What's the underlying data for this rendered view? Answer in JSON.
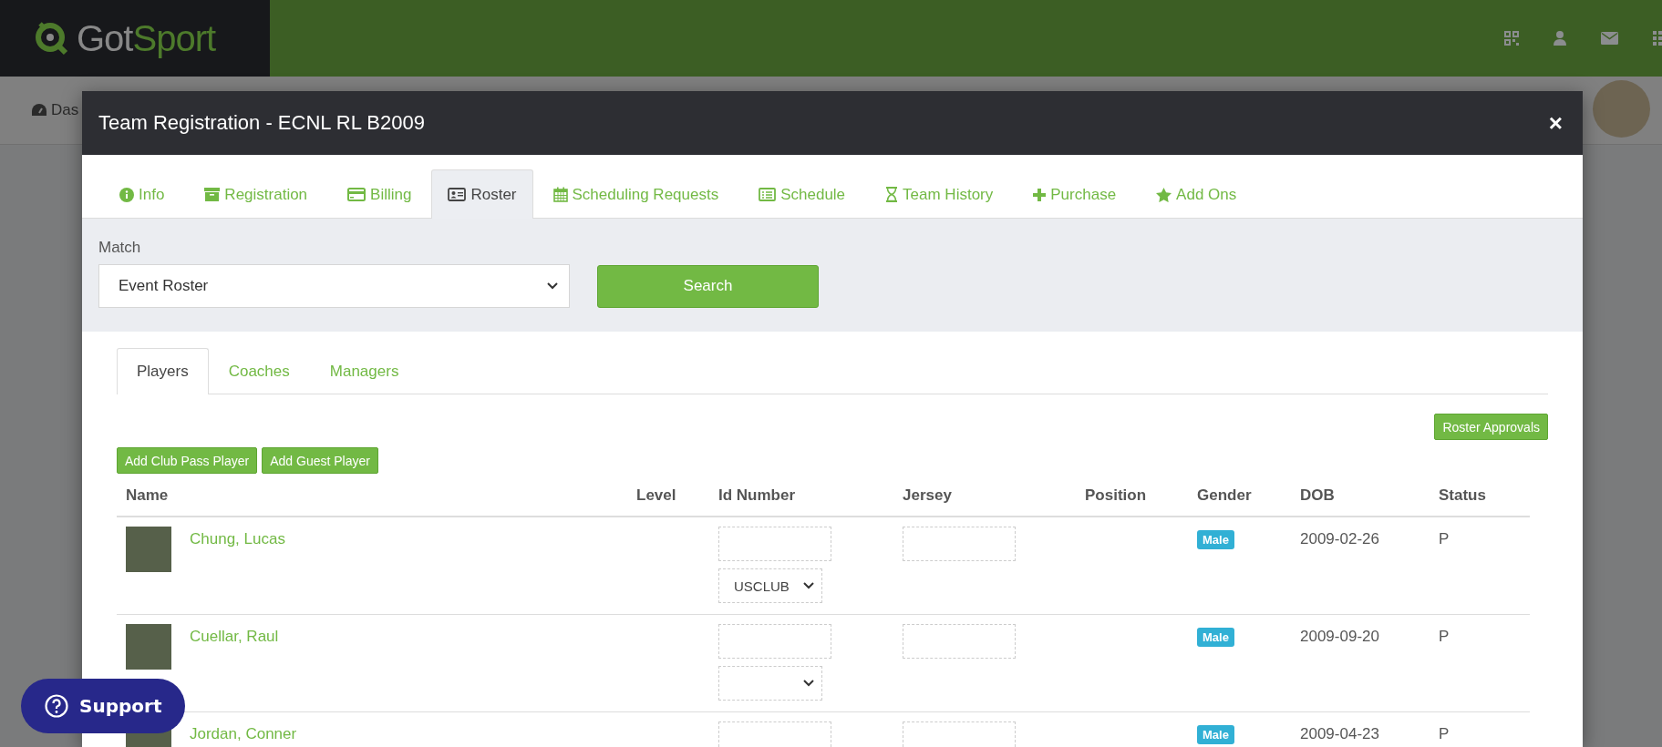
{
  "header": {
    "logo": {
      "part_1": "Got",
      "part_2": "Sport"
    },
    "nav_item": "Das"
  },
  "modal": {
    "title": "Team Registration - ECNL RL B2009",
    "close": "×",
    "tabs": [
      {
        "label": "Info",
        "selected": false
      },
      {
        "label": "Registration",
        "selected": false
      },
      {
        "label": "Billing",
        "selected": false
      },
      {
        "label": "Roster",
        "selected": true
      },
      {
        "label": "Scheduling Requests",
        "selected": false
      },
      {
        "label": "Schedule",
        "selected": false
      },
      {
        "label": "Team History",
        "selected": false
      },
      {
        "label": "Purchase",
        "selected": false
      },
      {
        "label": "Add Ons",
        "selected": false
      }
    ],
    "match": {
      "label": "Match",
      "value": "Event Roster",
      "button": "Search"
    },
    "roster": {
      "tabs": [
        {
          "label": "Players",
          "selected": true
        },
        {
          "label": "Coaches",
          "selected": false
        },
        {
          "label": "Managers",
          "selected": false
        }
      ],
      "approvals_button": "Roster Approvals",
      "add_buttons": [
        "Add Club Pass Player",
        "Add Guest Player"
      ],
      "columns": [
        "Name",
        "Level",
        "Id Number",
        "Jersey",
        "Position",
        "Gender",
        "DOB",
        "Status"
      ],
      "rows": [
        {
          "name": "Chung, Lucas",
          "id_type": "USCLUB",
          "gender": "Male",
          "dob": "2009-02-26",
          "status": "P"
        },
        {
          "name": "Cuellar, Raul",
          "gender": "Male",
          "dob": "2009-09-20",
          "status": "P"
        },
        {
          "name": "Jordan, Conner",
          "gender": "Male",
          "dob": "2009-04-23",
          "status": "P"
        }
      ]
    }
  },
  "support": {
    "label": "Support"
  }
}
